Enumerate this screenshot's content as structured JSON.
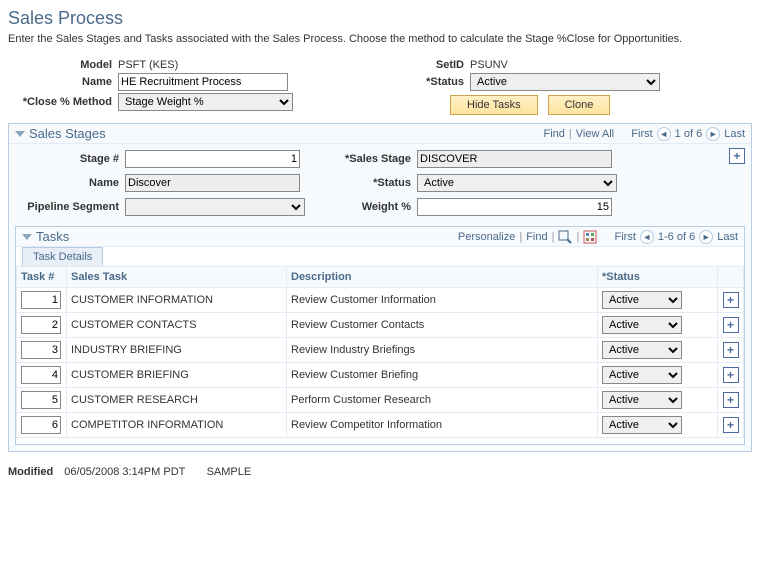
{
  "page": {
    "title": "Sales Process",
    "desc": "Enter the Sales Stages and Tasks associated with the Sales Process. Choose the method to calculate the Stage %Close for Opportunities."
  },
  "top": {
    "model_label": "Model",
    "model_value": "PSFT (KES)",
    "name_label": "Name",
    "name_value": "HE Recruitment Process",
    "close_label": "Close % Method",
    "close_value": "Stage Weight %",
    "setid_label": "SetID",
    "setid_value": "PSUNV",
    "status_label": "Status",
    "status_value": "Active",
    "hide_btn": "Hide Tasks",
    "clone_btn": "Clone"
  },
  "stages": {
    "title": "Sales Stages",
    "find": "Find",
    "viewall": "View All",
    "first": "First",
    "range": "1 of 6",
    "last": "Last",
    "stage_num_label": "Stage #",
    "stage_num": "1",
    "sstage_label": "Sales Stage",
    "sstage": "DISCOVER",
    "name_label": "Name",
    "name": "Discover",
    "status_label": "Status",
    "status": "Active",
    "pipe_label": "Pipeline Segment",
    "pipe": "",
    "weight_label": "Weight %",
    "weight": "15"
  },
  "tasks": {
    "title": "Tasks",
    "personalize": "Personalize",
    "find": "Find",
    "first": "First",
    "range": "1-6 of 6",
    "last": "Last",
    "tab": "Task Details",
    "cols": {
      "num": "Task #",
      "stask": "Sales Task",
      "desc": "Description",
      "status": "*Status"
    },
    "rows": [
      {
        "num": "1",
        "stask": "CUSTOMER INFORMATION",
        "desc": "Review Customer Information",
        "status": "Active"
      },
      {
        "num": "2",
        "stask": "CUSTOMER CONTACTS",
        "desc": "Review Customer Contacts",
        "status": "Active"
      },
      {
        "num": "3",
        "stask": "INDUSTRY BRIEFING",
        "desc": "Review Industry Briefings",
        "status": "Active"
      },
      {
        "num": "4",
        "stask": "CUSTOMER BRIEFING",
        "desc": "Review Customer Briefing",
        "status": "Active"
      },
      {
        "num": "5",
        "stask": "CUSTOMER RESEARCH",
        "desc": "Perform Customer Research",
        "status": "Active"
      },
      {
        "num": "6",
        "stask": "COMPETITOR INFORMATION",
        "desc": "Review Competitor Information",
        "status": "Active"
      }
    ]
  },
  "footer": {
    "mod_label": "Modified",
    "datetime": "06/05/2008  3:14PM PDT",
    "user": "SAMPLE"
  }
}
